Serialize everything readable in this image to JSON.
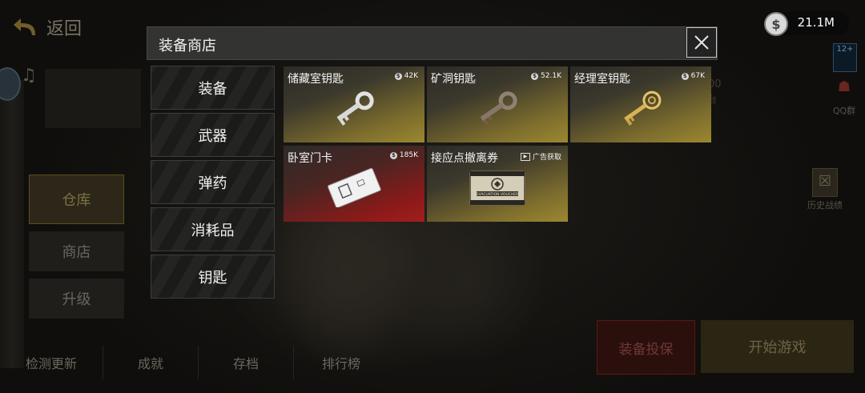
{
  "background": {
    "back_label": "返回",
    "side_menu": [
      "仓库",
      "商店",
      "升级"
    ],
    "bottom_menu": [
      "检测更新",
      "成就",
      "存档",
      "排行榜"
    ],
    "insure_button": "装备投保",
    "start_button": "开始游戏",
    "currency_amount": "21.1M",
    "age_badge": "12+",
    "qq_label": "QQ群",
    "history_label": "历史战绩",
    "partial_num": "00",
    "partial_text": "台"
  },
  "shop": {
    "title": "装备商店",
    "categories": [
      "装备",
      "武器",
      "弹药",
      "消耗品",
      "钥匙"
    ],
    "items": [
      {
        "name": "储藏室钥匙",
        "price": "42K",
        "price_type": "coin",
        "rarity": "gold",
        "icon": "silver-key-icon"
      },
      {
        "name": "矿洞钥匙",
        "price": "52.1K",
        "price_type": "coin",
        "rarity": "gold",
        "icon": "rusty-key-icon"
      },
      {
        "name": "经理室钥匙",
        "price": "67K",
        "price_type": "coin",
        "rarity": "gold",
        "icon": "gold-key-icon"
      },
      {
        "name": "卧室门卡",
        "price": "185K",
        "price_type": "coin",
        "rarity": "red",
        "icon": "keycard-icon"
      },
      {
        "name": "接应点撤离券",
        "price": "广告获取",
        "price_type": "ad",
        "rarity": "gold",
        "icon": "evacuation-voucher-icon",
        "voucher_text": "EVACUATION VOUCHER"
      }
    ]
  },
  "colors": {
    "gold_rarity": "#9b8731",
    "red_rarity": "#a11f1c",
    "modal_bar": "#333331"
  }
}
